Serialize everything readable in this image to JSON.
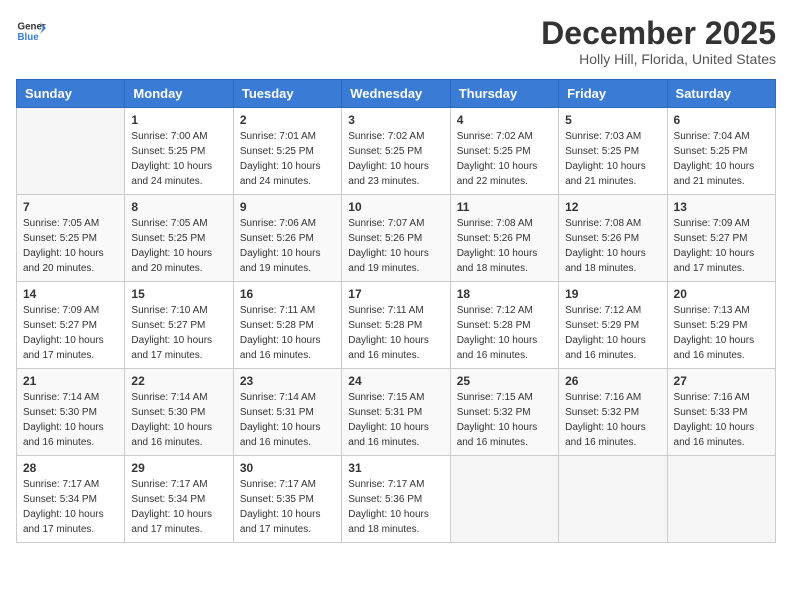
{
  "header": {
    "logo_general": "General",
    "logo_blue": "Blue",
    "month": "December 2025",
    "location": "Holly Hill, Florida, United States"
  },
  "weekdays": [
    "Sunday",
    "Monday",
    "Tuesday",
    "Wednesday",
    "Thursday",
    "Friday",
    "Saturday"
  ],
  "weeks": [
    [
      {
        "day": "",
        "info": ""
      },
      {
        "day": "1",
        "info": "Sunrise: 7:00 AM\nSunset: 5:25 PM\nDaylight: 10 hours\nand 24 minutes."
      },
      {
        "day": "2",
        "info": "Sunrise: 7:01 AM\nSunset: 5:25 PM\nDaylight: 10 hours\nand 24 minutes."
      },
      {
        "day": "3",
        "info": "Sunrise: 7:02 AM\nSunset: 5:25 PM\nDaylight: 10 hours\nand 23 minutes."
      },
      {
        "day": "4",
        "info": "Sunrise: 7:02 AM\nSunset: 5:25 PM\nDaylight: 10 hours\nand 22 minutes."
      },
      {
        "day": "5",
        "info": "Sunrise: 7:03 AM\nSunset: 5:25 PM\nDaylight: 10 hours\nand 21 minutes."
      },
      {
        "day": "6",
        "info": "Sunrise: 7:04 AM\nSunset: 5:25 PM\nDaylight: 10 hours\nand 21 minutes."
      }
    ],
    [
      {
        "day": "7",
        "info": "Sunrise: 7:05 AM\nSunset: 5:25 PM\nDaylight: 10 hours\nand 20 minutes."
      },
      {
        "day": "8",
        "info": "Sunrise: 7:05 AM\nSunset: 5:25 PM\nDaylight: 10 hours\nand 20 minutes."
      },
      {
        "day": "9",
        "info": "Sunrise: 7:06 AM\nSunset: 5:26 PM\nDaylight: 10 hours\nand 19 minutes."
      },
      {
        "day": "10",
        "info": "Sunrise: 7:07 AM\nSunset: 5:26 PM\nDaylight: 10 hours\nand 19 minutes."
      },
      {
        "day": "11",
        "info": "Sunrise: 7:08 AM\nSunset: 5:26 PM\nDaylight: 10 hours\nand 18 minutes."
      },
      {
        "day": "12",
        "info": "Sunrise: 7:08 AM\nSunset: 5:26 PM\nDaylight: 10 hours\nand 18 minutes."
      },
      {
        "day": "13",
        "info": "Sunrise: 7:09 AM\nSunset: 5:27 PM\nDaylight: 10 hours\nand 17 minutes."
      }
    ],
    [
      {
        "day": "14",
        "info": "Sunrise: 7:09 AM\nSunset: 5:27 PM\nDaylight: 10 hours\nand 17 minutes."
      },
      {
        "day": "15",
        "info": "Sunrise: 7:10 AM\nSunset: 5:27 PM\nDaylight: 10 hours\nand 17 minutes."
      },
      {
        "day": "16",
        "info": "Sunrise: 7:11 AM\nSunset: 5:28 PM\nDaylight: 10 hours\nand 16 minutes."
      },
      {
        "day": "17",
        "info": "Sunrise: 7:11 AM\nSunset: 5:28 PM\nDaylight: 10 hours\nand 16 minutes."
      },
      {
        "day": "18",
        "info": "Sunrise: 7:12 AM\nSunset: 5:28 PM\nDaylight: 10 hours\nand 16 minutes."
      },
      {
        "day": "19",
        "info": "Sunrise: 7:12 AM\nSunset: 5:29 PM\nDaylight: 10 hours\nand 16 minutes."
      },
      {
        "day": "20",
        "info": "Sunrise: 7:13 AM\nSunset: 5:29 PM\nDaylight: 10 hours\nand 16 minutes."
      }
    ],
    [
      {
        "day": "21",
        "info": "Sunrise: 7:14 AM\nSunset: 5:30 PM\nDaylight: 10 hours\nand 16 minutes."
      },
      {
        "day": "22",
        "info": "Sunrise: 7:14 AM\nSunset: 5:30 PM\nDaylight: 10 hours\nand 16 minutes."
      },
      {
        "day": "23",
        "info": "Sunrise: 7:14 AM\nSunset: 5:31 PM\nDaylight: 10 hours\nand 16 minutes."
      },
      {
        "day": "24",
        "info": "Sunrise: 7:15 AM\nSunset: 5:31 PM\nDaylight: 10 hours\nand 16 minutes."
      },
      {
        "day": "25",
        "info": "Sunrise: 7:15 AM\nSunset: 5:32 PM\nDaylight: 10 hours\nand 16 minutes."
      },
      {
        "day": "26",
        "info": "Sunrise: 7:16 AM\nSunset: 5:32 PM\nDaylight: 10 hours\nand 16 minutes."
      },
      {
        "day": "27",
        "info": "Sunrise: 7:16 AM\nSunset: 5:33 PM\nDaylight: 10 hours\nand 16 minutes."
      }
    ],
    [
      {
        "day": "28",
        "info": "Sunrise: 7:17 AM\nSunset: 5:34 PM\nDaylight: 10 hours\nand 17 minutes."
      },
      {
        "day": "29",
        "info": "Sunrise: 7:17 AM\nSunset: 5:34 PM\nDaylight: 10 hours\nand 17 minutes."
      },
      {
        "day": "30",
        "info": "Sunrise: 7:17 AM\nSunset: 5:35 PM\nDaylight: 10 hours\nand 17 minutes."
      },
      {
        "day": "31",
        "info": "Sunrise: 7:17 AM\nSunset: 5:36 PM\nDaylight: 10 hours\nand 18 minutes."
      },
      {
        "day": "",
        "info": ""
      },
      {
        "day": "",
        "info": ""
      },
      {
        "day": "",
        "info": ""
      }
    ]
  ]
}
